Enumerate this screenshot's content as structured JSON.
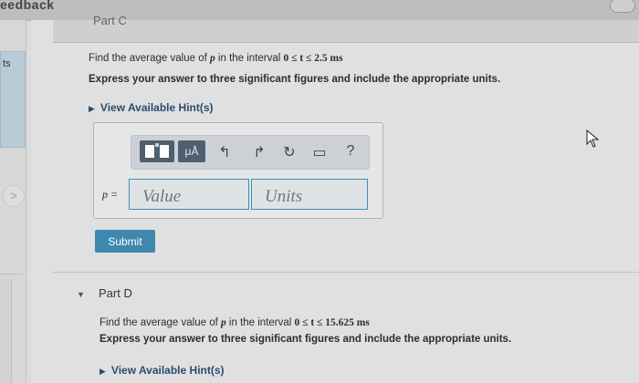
{
  "top": {
    "title": "eedback",
    "part_label": "Part C"
  },
  "left": {
    "tab_text": "ts",
    "nav_arrow": ">"
  },
  "partC": {
    "q1_prefix": "Find the average value of ",
    "q1_var": "p",
    "q1_mid": " in the interval ",
    "q1_math": "0 ≤ t ≤ 2.5 ms",
    "q2": "Express your answer to three significant figures and include the appropriate units.",
    "hint": "View Available Hint(s)",
    "toolbar": {
      "units_button": "μÅ",
      "undo_icon": "↰",
      "redo_icon": "↱",
      "reset_icon": "↻",
      "keyboard_icon": "▭",
      "help_icon": "?"
    },
    "eq_label": "p =",
    "value_placeholder": "Value",
    "units_placeholder": "Units",
    "submit": "Submit"
  },
  "partD": {
    "title": "Part D",
    "q1_prefix": "Find the average value of ",
    "q1_var": "p",
    "q1_mid": " in the interval ",
    "q1_math": "0 ≤ t ≤ 15.625 ms",
    "q2": "Express your answer to three significant figures and include the appropriate units.",
    "hint": "View Available Hint(s)"
  },
  "colors": {
    "accent": "#3e88b0",
    "toolbar_dark": "#4e5f70",
    "link": "#2a4d6e"
  }
}
